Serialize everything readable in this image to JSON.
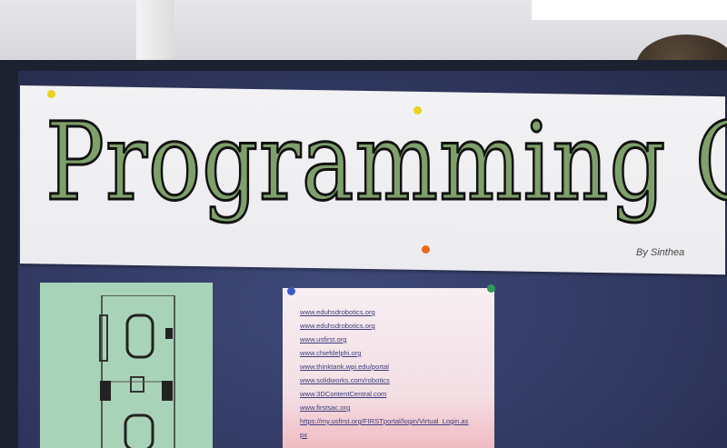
{
  "banner": {
    "title": "Programming Cave",
    "signature": "By Sinthea"
  },
  "links_sheet": {
    "links": [
      "www.eduhsdrobotics.org",
      "www.eduhsdrobotics.org",
      "www.usfirst.org",
      "www.chiefdelphi.org",
      "www.thinktank.wpi.edu/portal",
      "www.solidworks.com/robotics",
      "www.3DContentCentral.com",
      "www.firstsac.org",
      "https://my.usfirst.org/FIRSTportal/login/Virtual_Login.as",
      "px"
    ]
  },
  "colors": {
    "board": "#2e355c",
    "banner_paper": "#f0f0f3",
    "letter_fill": "#7fa06a",
    "green_sheet": "#a9d3b8",
    "pin_yellow": "#e8d21e",
    "pin_orange": "#e86a1e",
    "pin_blue": "#3b5bc9",
    "pin_green": "#2f9a5a"
  }
}
